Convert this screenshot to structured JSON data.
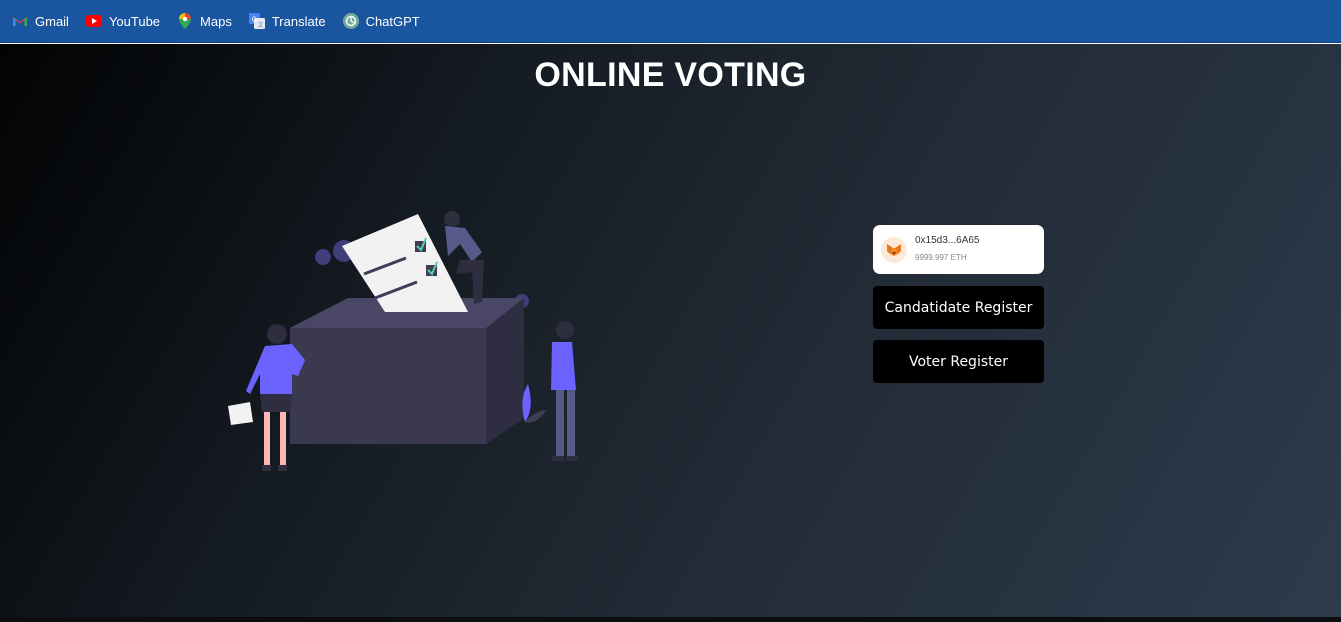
{
  "bookmarks": [
    {
      "label": "Gmail",
      "icon": "gmail-icon"
    },
    {
      "label": "YouTube",
      "icon": "youtube-icon"
    },
    {
      "label": "Maps",
      "icon": "maps-icon"
    },
    {
      "label": "Translate",
      "icon": "translate-icon"
    },
    {
      "label": "ChatGPT",
      "icon": "chatgpt-icon"
    }
  ],
  "page": {
    "title": "ONLINE VOTING"
  },
  "wallet": {
    "address": "0x15d3...6A65",
    "balance": "9999.997 ETH",
    "icon": "metamask-fox-icon"
  },
  "buttons": {
    "candidate": "Candatidate Register",
    "voter": "Voter Register"
  },
  "colors": {
    "bookmark_bar": "#1a56a0",
    "accent_purple": "#6c63ff",
    "button_bg": "#000000"
  }
}
